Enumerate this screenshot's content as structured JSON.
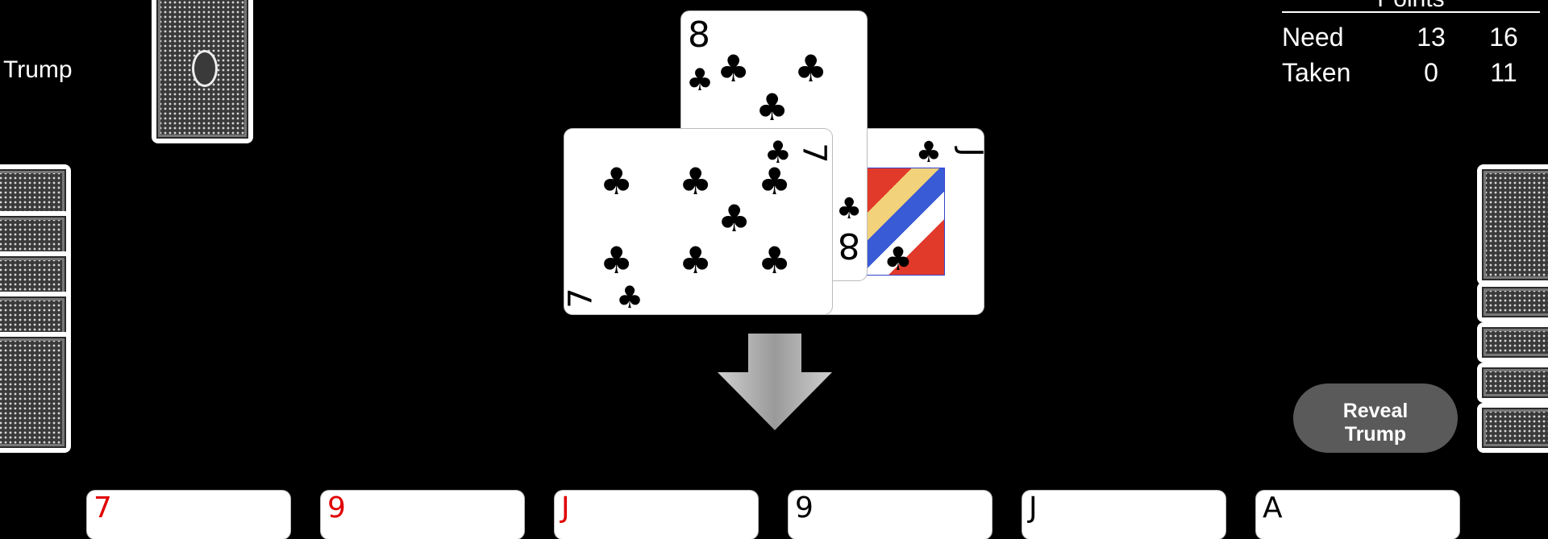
{
  "trump": {
    "label": "Trump"
  },
  "points": {
    "header": "Points",
    "rows": [
      {
        "label": "Need",
        "a": "13",
        "b": "16"
      },
      {
        "label": "Taken",
        "a": "0",
        "b": "11"
      }
    ]
  },
  "reveal_button": {
    "line1": "Reveal",
    "line2": "Trump"
  },
  "trick": [
    {
      "rank": "8",
      "suit": "♣"
    },
    {
      "rank": "7",
      "suit": "♣"
    },
    {
      "rank": "J",
      "suit": "♣"
    }
  ],
  "hand": [
    {
      "rank": "7",
      "color": "red"
    },
    {
      "rank": "9",
      "color": "red"
    },
    {
      "rank": "J",
      "color": "red"
    },
    {
      "rank": "9",
      "color": "black"
    },
    {
      "rank": "J",
      "color": "black"
    },
    {
      "rank": "A",
      "color": "black"
    }
  ]
}
